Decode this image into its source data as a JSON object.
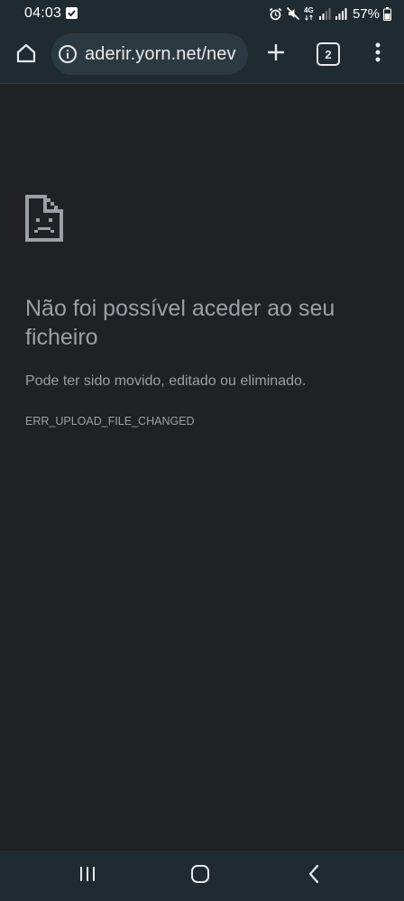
{
  "status_bar": {
    "time": "04:03",
    "network": "4G",
    "battery_percent": "57%"
  },
  "toolbar": {
    "url": "aderir.yorn.net/nev",
    "tab_count": "2"
  },
  "error": {
    "title": "Não foi possível aceder ao seu ficheiro",
    "description": "Pode ter sido movido, editado ou eliminado.",
    "code": "ERR_UPLOAD_FILE_CHANGED"
  },
  "icons": {
    "home": "home-icon",
    "info": "info-icon",
    "new_tab": "plus-icon",
    "menu": "more-vert-icon",
    "error_file": "sad-file-icon",
    "recents": "recents-icon",
    "nav_home": "nav-home-icon",
    "back": "back-icon"
  },
  "colors": {
    "page_background": "#202124",
    "bar_background": "#1f2b30",
    "omnibox_background": "#2b3a40",
    "text_primary": "#e8eaed",
    "text_secondary": "#9aa0a6"
  }
}
